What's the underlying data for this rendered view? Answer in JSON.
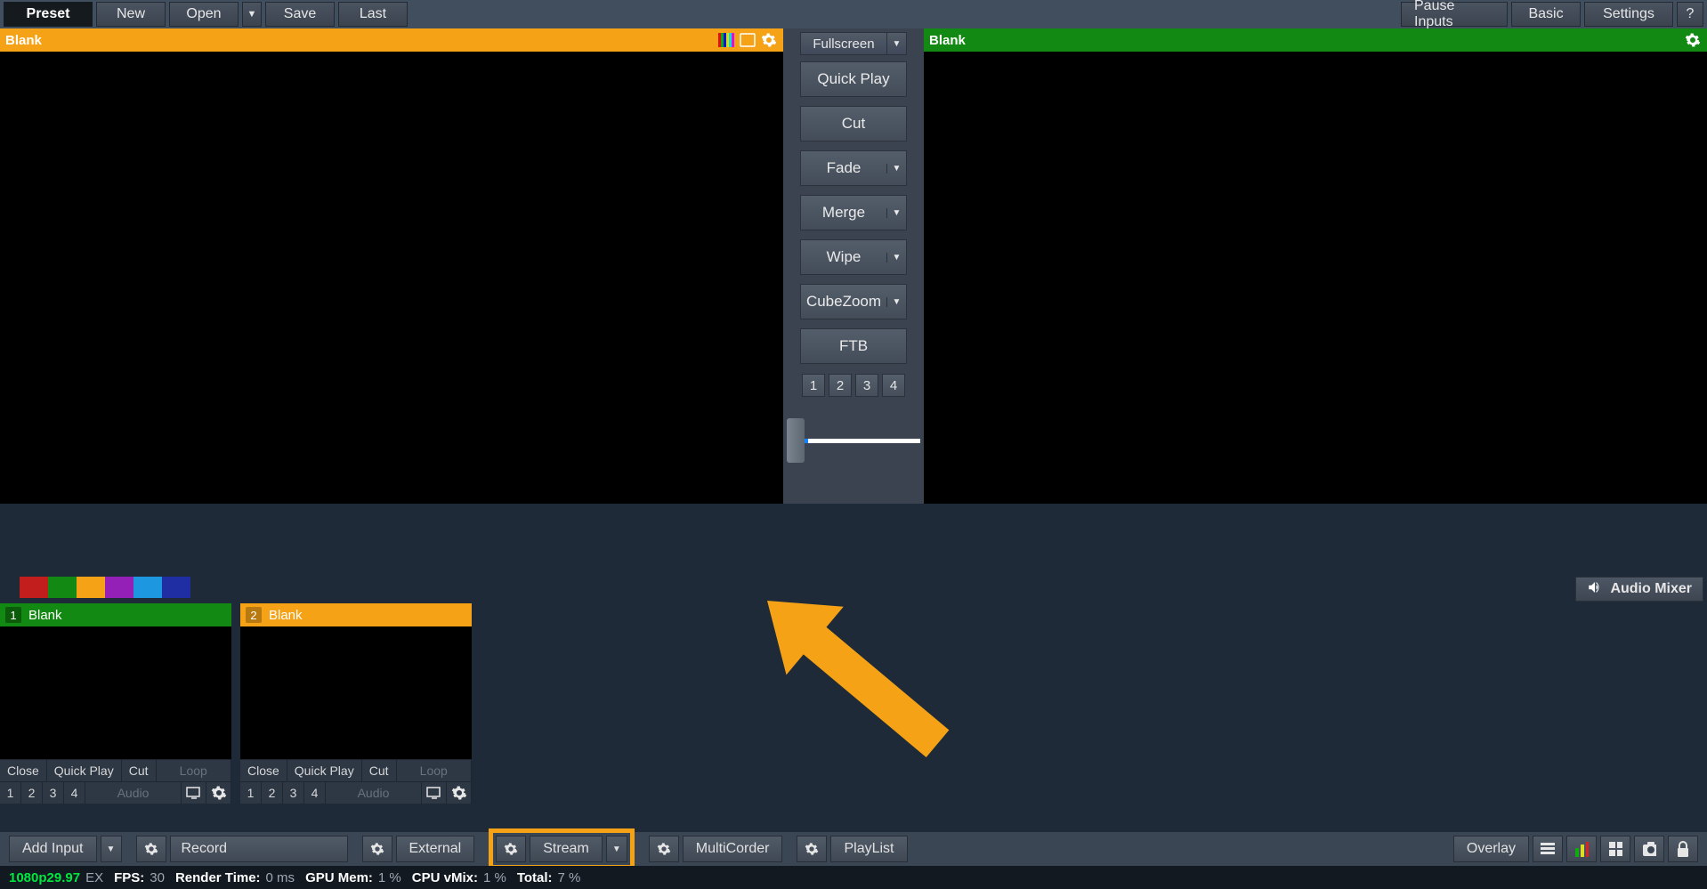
{
  "topbar": {
    "preset": "Preset",
    "new": "New",
    "open": "Open",
    "save": "Save",
    "last": "Last",
    "pause_inputs": "Pause Inputs",
    "basic": "Basic",
    "settings": "Settings",
    "help": "?"
  },
  "preview": {
    "title": "Blank"
  },
  "output": {
    "title": "Blank"
  },
  "transitions": {
    "fullscreen": "Fullscreen",
    "quick_play": "Quick Play",
    "cut": "Cut",
    "fade": "Fade",
    "merge": "Merge",
    "wipe": "Wipe",
    "cubezoom": "CubeZoom",
    "ftb": "FTB",
    "overlays": [
      "1",
      "2",
      "3",
      "4"
    ]
  },
  "audio_mixer": "Audio Mixer",
  "colour_tabs": [
    "#c31e1e",
    "#128912",
    "#f5a216",
    "#9420b7",
    "#1d97e0",
    "#1f2fa3"
  ],
  "inputs": [
    {
      "num": "1",
      "title": "Blank",
      "colour": "green",
      "row1": [
        "Close",
        "Quick Play",
        "Cut",
        "Loop"
      ],
      "row2_nums": [
        "1",
        "2",
        "3",
        "4"
      ],
      "row2_audio": "Audio"
    },
    {
      "num": "2",
      "title": "Blank",
      "colour": "orange",
      "row1": [
        "Close",
        "Quick Play",
        "Cut",
        "Loop"
      ],
      "row2_nums": [
        "1",
        "2",
        "3",
        "4"
      ],
      "row2_audio": "Audio"
    }
  ],
  "bottom": {
    "add_input": "Add Input",
    "record": "Record",
    "external": "External",
    "stream": "Stream",
    "multicorder": "MultiCorder",
    "playlist": "PlayList",
    "overlay": "Overlay"
  },
  "status": {
    "format": "1080p29.97",
    "ex": "EX",
    "fps_label": "FPS:",
    "fps": "30",
    "render_label": "Render Time:",
    "render": "0 ms",
    "gpu_label": "GPU Mem:",
    "gpu": "1 %",
    "cpu_label": "CPU vMix:",
    "cpu": "1 %",
    "total_label": "Total:",
    "total": "7 %"
  }
}
